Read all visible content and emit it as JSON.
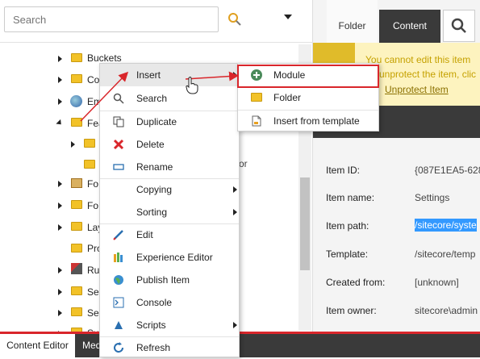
{
  "search": {
    "placeholder": "Search"
  },
  "tree": {
    "items": [
      {
        "label": "Buckets"
      },
      {
        "label": "Co"
      },
      {
        "label": "Em"
      },
      {
        "label": "Fea"
      },
      {
        "label": ""
      },
      {
        "label": ""
      },
      {
        "label": "Fo"
      },
      {
        "label": "Fo"
      },
      {
        "label": "Lay"
      },
      {
        "label": "Pro"
      },
      {
        "label": "Ru"
      },
      {
        "label": "Se"
      },
      {
        "label": "Ser"
      },
      {
        "label": "Sy"
      }
    ],
    "truncated_text": "or"
  },
  "context_menu": {
    "items": [
      {
        "label": "Insert",
        "icon": "none",
        "submenu": true
      },
      {
        "label": "Search",
        "icon": "search-icon"
      },
      {
        "label": "Duplicate",
        "icon": "duplicate-icon"
      },
      {
        "label": "Delete",
        "icon": "delete-x-icon"
      },
      {
        "label": "Rename",
        "icon": "rename-icon"
      },
      {
        "label": "Copying",
        "icon": "none",
        "submenu": true
      },
      {
        "label": "Sorting",
        "icon": "none",
        "submenu": true
      },
      {
        "label": "Edit",
        "icon": "pencil-icon"
      },
      {
        "label": "Experience Editor",
        "icon": "experience-editor-icon"
      },
      {
        "label": "Publish Item",
        "icon": "globe-icon"
      },
      {
        "label": "Console",
        "icon": "console-icon"
      },
      {
        "label": "Scripts",
        "icon": "scripts-icon",
        "submenu": true
      },
      {
        "label": "Refresh",
        "icon": "refresh-icon"
      }
    ]
  },
  "insert_submenu": {
    "items": [
      {
        "label": "Module",
        "icon": "plus-circle-icon"
      },
      {
        "label": "Folder",
        "icon": "folder-icon"
      },
      {
        "label": "Insert from template",
        "icon": "template-icon"
      }
    ]
  },
  "tabs": {
    "folder": "Folder",
    "content": "Content"
  },
  "warning": {
    "line1": "You cannot edit this item",
    "line2": "unprotect the item, clic",
    "link": "Unprotect Item"
  },
  "details": [
    {
      "label": "Item ID:",
      "value": "{087E1EA5-628"
    },
    {
      "label": "Item name:",
      "value": "Settings"
    },
    {
      "label": "Item path:",
      "value": "/sitecore/syste"
    },
    {
      "label": "Template:",
      "value": "/sitecore/temp"
    },
    {
      "label": "Created from:",
      "value": "[unknown]"
    },
    {
      "label": "Item owner:",
      "value": "sitecore\\admin"
    }
  ],
  "bottom_tabs": {
    "content_editor": "Content Editor",
    "media": "Med"
  },
  "colors": {
    "highlight_red": "#d9262b",
    "warning_bg": "#fdf3bf",
    "warning_text": "#c5a100",
    "dark_tab": "#3a3a3a",
    "selection": "#3399ff"
  }
}
